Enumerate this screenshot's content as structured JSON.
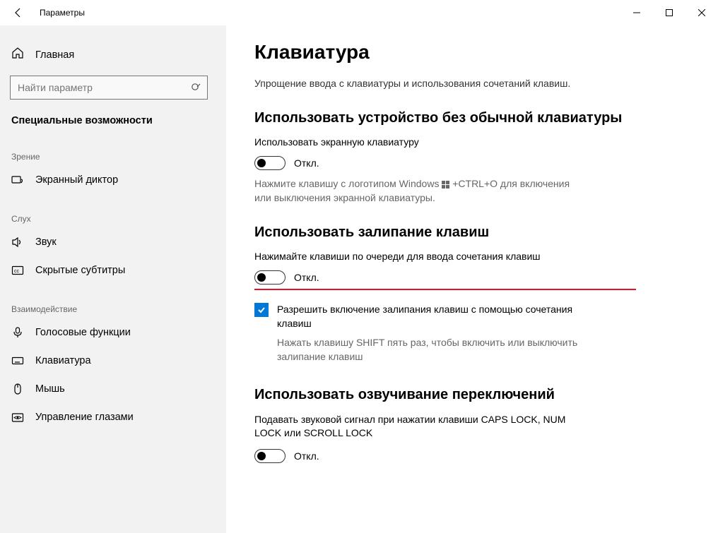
{
  "titlebar": {
    "title": "Параметры"
  },
  "sidebar": {
    "home": "Главная",
    "search_placeholder": "Найти параметр",
    "category": "Специальные возможности",
    "groups": [
      {
        "label": "Зрение",
        "items": [
          {
            "label": "Экранный диктор"
          }
        ]
      },
      {
        "label": "Слух",
        "items": [
          {
            "label": "Звук"
          },
          {
            "label": "Скрытые субтитры"
          }
        ]
      },
      {
        "label": "Взаимодействие",
        "items": [
          {
            "label": "Голосовые функции"
          },
          {
            "label": "Клавиатура"
          },
          {
            "label": "Мышь"
          },
          {
            "label": "Управление глазами"
          }
        ]
      }
    ]
  },
  "main": {
    "title": "Клавиатура",
    "desc": "Упрощение ввода с клавиатуры и использования сочетаний клавиш.",
    "section1": {
      "title": "Использовать устройство без обычной клавиатуры",
      "label": "Использовать экранную клавиатуру",
      "toggle_text": "Откл.",
      "hint_before": "Нажмите клавишу с логотипом Windows ",
      "hint_after": " +CTRL+O для включения или выключения экранной клавиатуры."
    },
    "section2": {
      "title": "Использовать залипание клавиш",
      "label": "Нажимайте клавиши по очереди для ввода сочетания клавиш",
      "toggle_text": "Откл.",
      "checkbox_label": "Разрешить включение залипания клавиш с помощью сочетания клавиш",
      "checkbox_hint": "Нажать клавишу SHIFT пять раз, чтобы включить или выключить залипание клавиш"
    },
    "section3": {
      "title": "Использовать озвучивание переключений",
      "desc": "Подавать звуковой сигнал при нажатии клавиши CAPS LOCK, NUM LOCK или SCROLL LOCK",
      "toggle_text": "Откл."
    }
  }
}
